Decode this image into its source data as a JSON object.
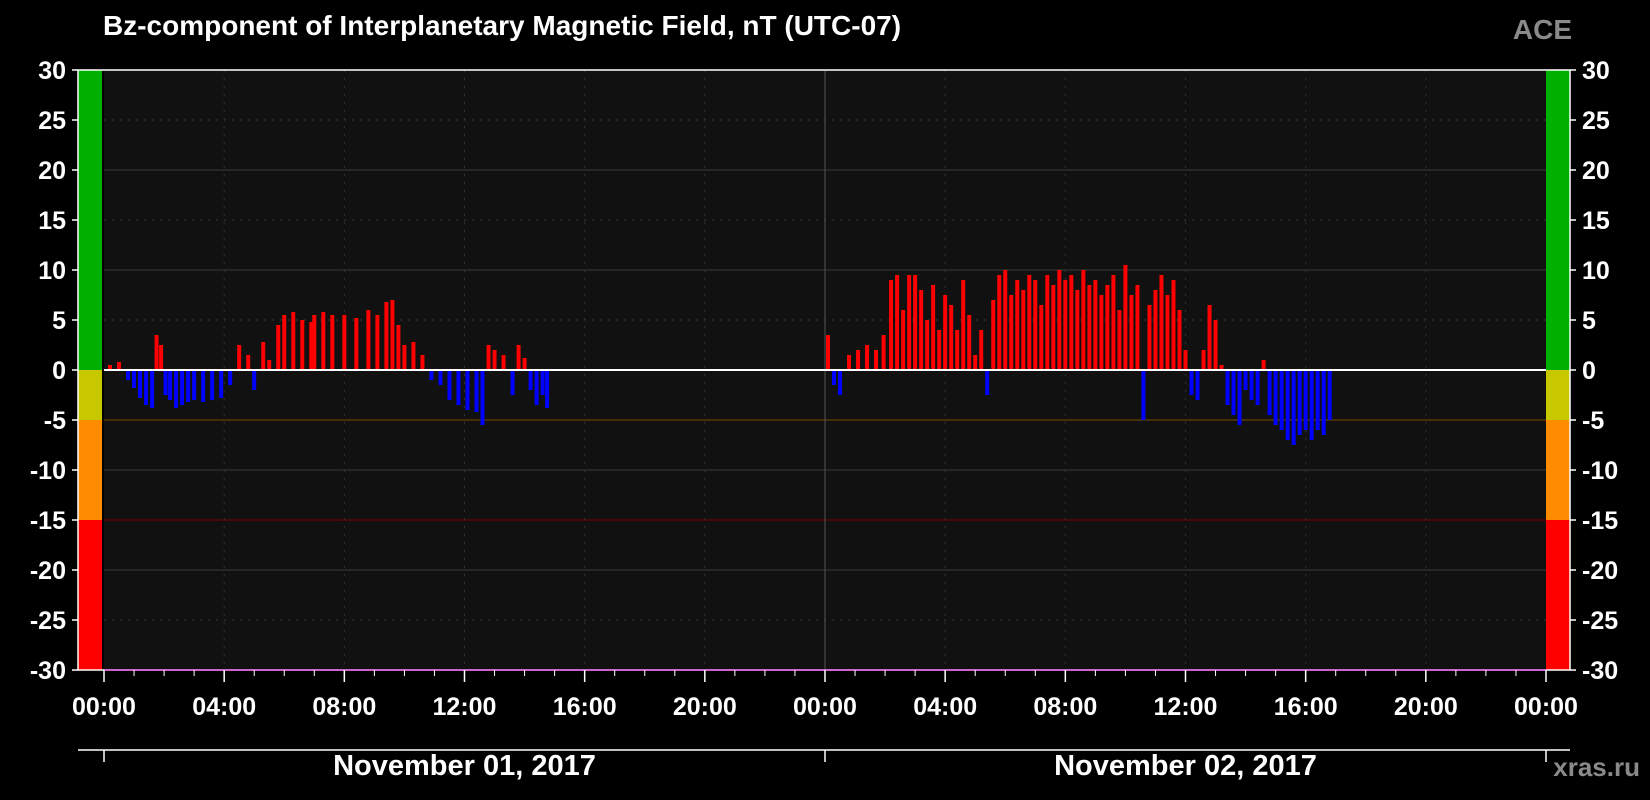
{
  "chart_data": {
    "type": "bar",
    "title": "Bz-component of Interplanetary Magnetic Field, nT (UTC-07)",
    "source": "ACE",
    "credit": "xras.ru",
    "ylim": [
      -30,
      30
    ],
    "yticks": [
      30,
      25,
      20,
      15,
      10,
      5,
      0,
      -5,
      -10,
      -15,
      -20,
      -25,
      -30
    ],
    "xticks_hours": [
      0,
      4,
      8,
      12,
      16,
      20,
      24,
      28,
      32,
      36,
      40,
      44,
      48
    ],
    "xtick_labels": [
      "00:00",
      "04:00",
      "08:00",
      "12:00",
      "16:00",
      "20:00",
      "00:00",
      "04:00",
      "08:00",
      "12:00",
      "16:00",
      "20:00",
      "00:00"
    ],
    "dates": [
      {
        "label": "November 01, 2017",
        "center_hour": 12
      },
      {
        "label": "November 02, 2017",
        "center_hour": 36
      }
    ],
    "x_range_hours": [
      0,
      48
    ],
    "grid": true,
    "color_scale": [
      {
        "from": 0,
        "to": 30,
        "color": "#00b000"
      },
      {
        "from": -5,
        "to": 0,
        "color": "#c8c800"
      },
      {
        "from": -15,
        "to": -5,
        "color": "#ff8c00"
      },
      {
        "from": -30,
        "to": -15,
        "color": "#ff0000"
      }
    ],
    "positive_color": "#ff0000",
    "negative_color": "#0000ff",
    "series": [
      {
        "x_hours": [
          0.2,
          0.5,
          0.8,
          1.0,
          1.2,
          1.4,
          1.6,
          1.75,
          1.9,
          2.05,
          2.2,
          2.4,
          2.6,
          2.8,
          3.0,
          3.3,
          3.6,
          3.9,
          4.2,
          4.5,
          4.8,
          5.0,
          5.3,
          5.5,
          5.8,
          6.0,
          6.3,
          6.6,
          6.9,
          7.0,
          7.3,
          7.6,
          8.0,
          8.4,
          8.8,
          9.1,
          9.4,
          9.6,
          9.8,
          10.0,
          10.3,
          10.6,
          10.9,
          11.2,
          11.5,
          11.8,
          12.1,
          12.4,
          12.6,
          12.8,
          13.0,
          13.3,
          13.6,
          13.8,
          14.0,
          14.2,
          14.4,
          14.6,
          14.75
        ],
        "values": [
          0.5,
          0.8,
          -1.0,
          -1.8,
          -2.8,
          -3.5,
          -3.8,
          3.5,
          2.5,
          -2.5,
          -3.0,
          -3.8,
          -3.5,
          -3.2,
          -3.0,
          -3.2,
          -3.0,
          -2.8,
          -1.5,
          2.5,
          1.5,
          -2.0,
          2.8,
          1.0,
          4.5,
          5.5,
          5.8,
          5.0,
          4.8,
          5.5,
          5.8,
          5.5,
          5.5,
          5.2,
          6.0,
          5.5,
          6.8,
          7.0,
          4.5,
          2.5,
          2.8,
          1.5,
          -1.0,
          -1.5,
          -3.0,
          -3.5,
          -4.0,
          -4.2,
          -5.5,
          2.5,
          2.0,
          1.5,
          -2.5,
          2.5,
          1.2,
          -2.0,
          -3.5,
          -2.5,
          -3.8
        ]
      },
      {
        "x_hours": [
          24.1,
          24.3,
          24.5,
          24.8,
          25.1,
          25.4,
          25.7,
          25.95,
          26.2,
          26.4,
          26.6,
          26.8,
          27.0,
          27.2,
          27.4,
          27.6,
          27.8,
          28.0,
          28.2,
          28.4,
          28.6,
          28.8,
          29.0,
          29.2,
          29.4,
          29.6,
          29.8,
          30.0,
          30.2,
          30.4,
          30.6,
          30.8,
          31.0,
          31.2,
          31.4,
          31.6,
          31.8,
          32.0,
          32.2,
          32.4,
          32.6,
          32.8,
          33.0,
          33.2,
          33.4,
          33.6,
          33.8,
          34.0,
          34.2,
          34.4,
          34.6,
          34.8,
          35.0,
          35.2,
          35.4,
          35.6,
          35.8,
          36.0,
          36.2,
          36.4,
          36.6,
          36.8,
          37.0,
          37.2,
          37.4,
          37.6,
          37.8,
          38.0,
          38.2,
          38.4,
          38.6,
          38.8,
          39.0,
          39.2,
          39.4,
          39.6,
          39.8,
          40.0,
          40.2,
          40.4,
          40.6,
          40.8
        ],
        "values": [
          3.5,
          -1.5,
          -2.5,
          1.5,
          2.0,
          2.5,
          2.0,
          3.5,
          9.0,
          9.5,
          6.0,
          9.5,
          9.5,
          8.0,
          5.0,
          8.5,
          4.0,
          7.5,
          6.5,
          4.0,
          9.0,
          5.5,
          1.5,
          4.0,
          -2.5,
          7.0,
          9.5,
          10.0,
          7.5,
          9.0,
          8.0,
          9.5,
          9.0,
          6.5,
          9.5,
          8.5,
          10.0,
          9.0,
          9.5,
          8.0,
          10.0,
          8.5,
          9.0,
          7.5,
          8.5,
          9.5,
          6.0,
          10.5,
          7.5,
          8.5,
          -5.0,
          6.5,
          8.0,
          9.5,
          7.5,
          9.0,
          6.0,
          2.0,
          -2.5,
          -3.0,
          2.0,
          6.5,
          5.0,
          0.5,
          -3.5,
          -4.5,
          -5.5,
          -2.0,
          -3.0,
          -3.5,
          1.0,
          -4.5,
          -5.5,
          -6.0,
          -7.0,
          -7.5,
          -6.5,
          -6.0,
          -7.0,
          -6.0,
          -6.5,
          -5.0
        ]
      }
    ]
  }
}
